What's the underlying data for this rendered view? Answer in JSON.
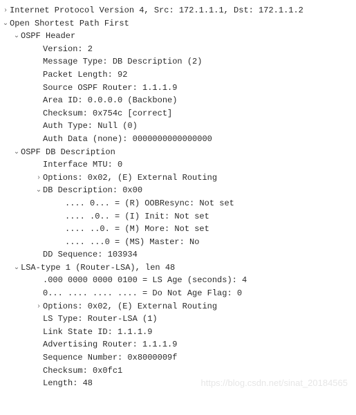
{
  "lines": [
    {
      "indent": 0,
      "toggle": "closed",
      "text": "Internet Protocol Version 4, Src: 172.1.1.1, Dst: 172.1.1.2",
      "name": "ipv4-summary",
      "interact": true
    },
    {
      "indent": 0,
      "toggle": "open",
      "text": "Open Shortest Path First",
      "name": "ospf-summary",
      "interact": true
    },
    {
      "indent": 1,
      "toggle": "open",
      "text": "OSPF Header",
      "name": "ospf-header",
      "interact": true
    },
    {
      "indent": 2,
      "toggle": null,
      "text": "Version: 2",
      "name": "ospf-version",
      "interact": false
    },
    {
      "indent": 2,
      "toggle": null,
      "text": "Message Type: DB Description (2)",
      "name": "ospf-msg-type",
      "interact": false
    },
    {
      "indent": 2,
      "toggle": null,
      "text": "Packet Length: 92",
      "name": "ospf-pkt-len",
      "interact": false
    },
    {
      "indent": 2,
      "toggle": null,
      "text": "Source OSPF Router: 1.1.1.9",
      "name": "ospf-src-router",
      "interact": false
    },
    {
      "indent": 2,
      "toggle": null,
      "text": "Area ID: 0.0.0.0 (Backbone)",
      "name": "ospf-area-id",
      "interact": false
    },
    {
      "indent": 2,
      "toggle": null,
      "text": "Checksum: 0x754c [correct]",
      "name": "ospf-checksum",
      "interact": false
    },
    {
      "indent": 2,
      "toggle": null,
      "text": "Auth Type: Null (0)",
      "name": "ospf-auth-type",
      "interact": false
    },
    {
      "indent": 2,
      "toggle": null,
      "text": "Auth Data (none): 0000000000000000",
      "name": "ospf-auth-data",
      "interact": false
    },
    {
      "indent": 1,
      "toggle": "open",
      "text": "OSPF DB Description",
      "name": "ospf-dbdesc",
      "interact": true
    },
    {
      "indent": 2,
      "toggle": null,
      "text": "Interface MTU: 0",
      "name": "dbdesc-mtu",
      "interact": false
    },
    {
      "indent": 2,
      "toggle": "closed",
      "text": "Options: 0x02, (E) External Routing",
      "name": "dbdesc-options",
      "interact": true
    },
    {
      "indent": 2,
      "toggle": "open",
      "text": "DB Description: 0x00",
      "name": "dbdesc-flags",
      "interact": true
    },
    {
      "indent": 3,
      "toggle": null,
      "text": ".... 0... = (R) OOBResync: Not set",
      "name": "flag-r",
      "interact": false
    },
    {
      "indent": 3,
      "toggle": null,
      "text": ".... .0.. = (I) Init: Not set",
      "name": "flag-i",
      "interact": false
    },
    {
      "indent": 3,
      "toggle": null,
      "text": ".... ..0. = (M) More: Not set",
      "name": "flag-m",
      "interact": false
    },
    {
      "indent": 3,
      "toggle": null,
      "text": ".... ...0 = (MS) Master: No",
      "name": "flag-ms",
      "interact": false
    },
    {
      "indent": 2,
      "toggle": null,
      "text": "DD Sequence: 103934",
      "name": "dd-sequence",
      "interact": false
    },
    {
      "indent": 1,
      "toggle": "open",
      "text": "LSA-type 1 (Router-LSA), len 48",
      "name": "lsa-header",
      "interact": true
    },
    {
      "indent": 2,
      "toggle": null,
      "text": ".000 0000 0000 0100 = LS Age (seconds): 4",
      "name": "ls-age",
      "interact": false
    },
    {
      "indent": 2,
      "toggle": null,
      "text": "0... .... .... .... = Do Not Age Flag: 0",
      "name": "do-not-age",
      "interact": false
    },
    {
      "indent": 2,
      "toggle": "closed",
      "text": "Options: 0x02, (E) External Routing",
      "name": "lsa-options",
      "interact": true
    },
    {
      "indent": 2,
      "toggle": null,
      "text": "LS Type: Router-LSA (1)",
      "name": "ls-type",
      "interact": false
    },
    {
      "indent": 2,
      "toggle": null,
      "text": "Link State ID: 1.1.1.9",
      "name": "link-state-id",
      "interact": false
    },
    {
      "indent": 2,
      "toggle": null,
      "text": "Advertising Router: 1.1.1.9",
      "name": "adv-router",
      "interact": false
    },
    {
      "indent": 2,
      "toggle": null,
      "text": "Sequence Number: 0x8000009f",
      "name": "seq-number",
      "interact": false
    },
    {
      "indent": 2,
      "toggle": null,
      "text": "Checksum: 0x0fc1",
      "name": "lsa-checksum",
      "interact": false
    },
    {
      "indent": 2,
      "toggle": null,
      "text": "Length: 48",
      "name": "lsa-length",
      "interact": false
    }
  ],
  "watermark": "https://blog.csdn.net/sinat_20184565"
}
